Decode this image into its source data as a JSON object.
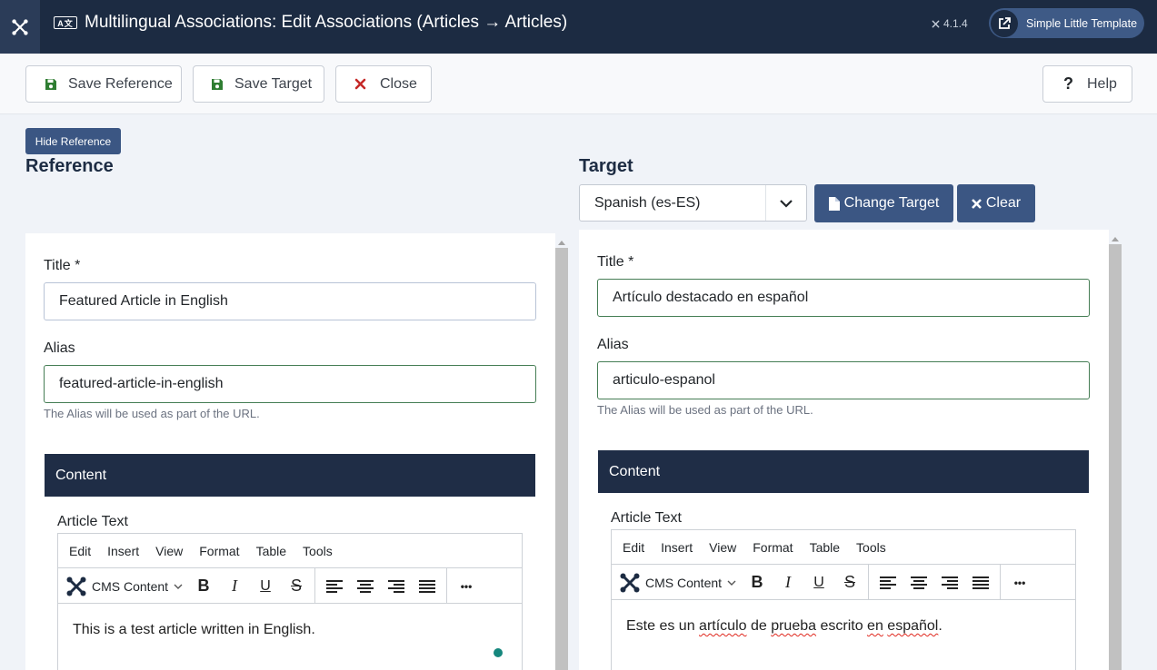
{
  "header": {
    "title": "Multilingual Associations: Edit Associations (Articles → Articles)",
    "lang_icon": "A文",
    "version": "4.1.4",
    "site_button": "Simple Little Template"
  },
  "toolbar": {
    "save_reference": "Save Reference",
    "save_target": "Save Target",
    "close": "Close",
    "help": "Help"
  },
  "hide_reference": "Hide Reference",
  "reference": {
    "heading": "Reference",
    "title_label": "Title *",
    "title_value": "Featured Article in English",
    "alias_label": "Alias",
    "alias_value": "featured-article-in-english",
    "alias_hint": "The Alias will be used as part of the URL.",
    "content_tab": "Content",
    "article_text_label": "Article Text",
    "article_text": "This is a test article written in English."
  },
  "target": {
    "heading": "Target",
    "language": "Spanish (es-ES)",
    "change_target": "Change Target",
    "clear": "Clear",
    "title_label": "Title *",
    "title_value": "Artículo destacado en español",
    "alias_label": "Alias",
    "alias_value": "articulo-espanol",
    "alias_hint": "The Alias will be used as part of the URL.",
    "content_tab": "Content",
    "article_text_label": "Article Text",
    "article_text_parts": [
      "Este es un ",
      "artículo",
      " de ",
      "prueba",
      " escrito ",
      "en",
      " ",
      "español",
      "."
    ]
  },
  "editor": {
    "menu": [
      "Edit",
      "Insert",
      "View",
      "Format",
      "Table",
      "Tools"
    ],
    "block_format": "CMS Content",
    "more": "•••"
  },
  "colors": {
    "header_bg": "#1c2b42",
    "accent": "#3b5683",
    "valid_border": "#457d54",
    "spellcheck": "#e0281e"
  }
}
